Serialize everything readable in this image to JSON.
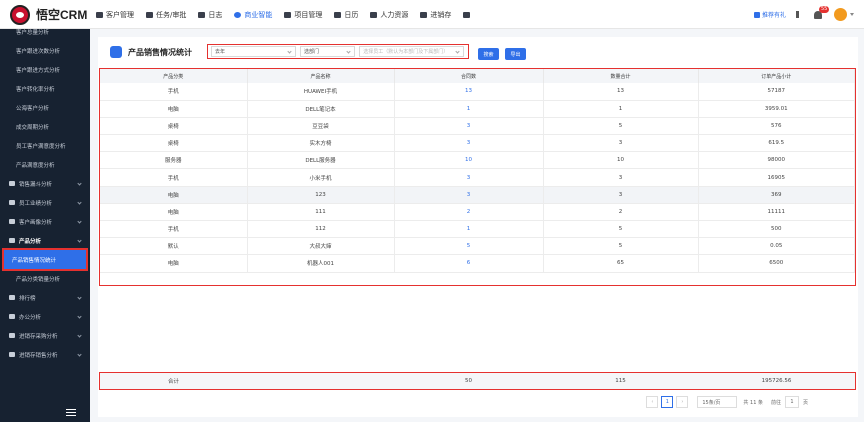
{
  "app": {
    "logo_text": "悟空CRM"
  },
  "nav": [
    {
      "label": "客户管理",
      "icon": "customer-icon"
    },
    {
      "label": "任务/审批",
      "icon": "task-icon"
    },
    {
      "label": "日志",
      "icon": "log-icon"
    },
    {
      "label": "商业智能",
      "icon": "bi-icon",
      "active": true
    },
    {
      "label": "项目管理",
      "icon": "project-icon"
    },
    {
      "label": "日历",
      "icon": "calendar-icon"
    },
    {
      "label": "人力资源",
      "icon": "hr-icon"
    },
    {
      "label": "进销存",
      "icon": "inventory-icon"
    }
  ],
  "topright": {
    "gift": "推荐有礼",
    "badge": "55"
  },
  "sidebar": [
    {
      "label": "客户总量分析",
      "type": "sub"
    },
    {
      "label": "客户跟进次数分析",
      "type": "sub"
    },
    {
      "label": "客户跟进方式分析",
      "type": "sub"
    },
    {
      "label": "客户转化率分析",
      "type": "sub"
    },
    {
      "label": "公海客户分析",
      "type": "sub"
    },
    {
      "label": "成交周期分析",
      "type": "sub"
    },
    {
      "label": "员工客户满意度分析",
      "type": "sub"
    },
    {
      "label": "产品满意度分析",
      "type": "sub"
    },
    {
      "label": "销售漏斗分析",
      "type": "group"
    },
    {
      "label": "员工业绩分析",
      "type": "group"
    },
    {
      "label": "客户画像分析",
      "type": "group"
    },
    {
      "label": "产品分析",
      "type": "open"
    },
    {
      "label": "产品销售情况统计",
      "type": "active"
    },
    {
      "label": "产品分类销量分析",
      "type": "sub"
    },
    {
      "label": "排行榜",
      "type": "group"
    },
    {
      "label": "办公分析",
      "type": "group"
    },
    {
      "label": "进销存采购分析",
      "type": "group"
    },
    {
      "label": "进销存销售分析",
      "type": "group"
    }
  ],
  "page": {
    "title": "产品销售情况统计"
  },
  "filters": {
    "period": "去年",
    "dept": "选部门",
    "user_placeholder": "选择员工（默认为本部门及下属部门）"
  },
  "buttons": {
    "search": "搜索",
    "export": "导出"
  },
  "table": {
    "headers": [
      "产品分类",
      "产品名称",
      "合同数",
      "数量合计",
      "订单产品小计"
    ],
    "rows": [
      [
        "手机",
        "HUAWEI手机",
        "13",
        "13",
        "57187"
      ],
      [
        "电脑",
        "DELL笔记本",
        "1",
        "1",
        "3959.01"
      ],
      [
        "桌椅",
        "豆豆袋",
        "3",
        "5",
        "576"
      ],
      [
        "桌椅",
        "实木方椅",
        "3",
        "3",
        "619.5"
      ],
      [
        "服务器",
        "DELL服务器",
        "10",
        "10",
        "98000"
      ],
      [
        "手机",
        "小米手机",
        "3",
        "3",
        "16905"
      ],
      [
        "电脑",
        "123",
        "3",
        "3",
        "369"
      ],
      [
        "电脑",
        "111",
        "2",
        "2",
        "11111"
      ],
      [
        "手机",
        "112",
        "1",
        "5",
        "500"
      ],
      [
        "默认",
        "大叔大婶",
        "5",
        "5",
        "0.05"
      ],
      [
        "电脑",
        "机器人001",
        "6",
        "65",
        "6500"
      ]
    ]
  },
  "summary": {
    "label": "合计",
    "contracts": "50",
    "quantity": "115",
    "subtotal": "195726.56"
  },
  "pager": {
    "page": "1",
    "size": "15条/页",
    "total": "共 11 条",
    "goto": "前往",
    "goto_page": "1",
    "unit": "页"
  }
}
